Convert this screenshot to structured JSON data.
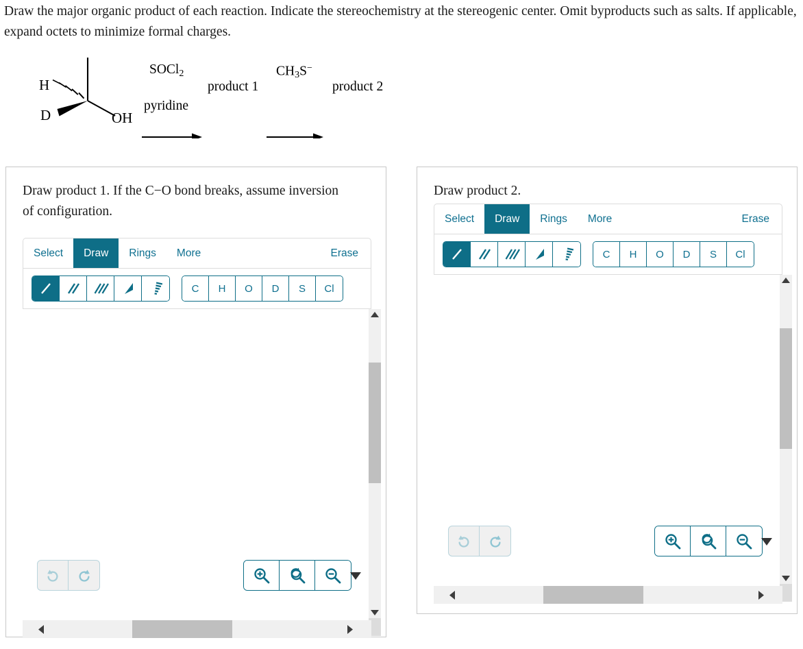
{
  "prompt": "Draw the major organic product of each reaction. Indicate the stereochemistry at the stereogenic center. Omit byproducts such as salts. If applicable, expand octets to minimize formal charges.",
  "reaction": {
    "substrate": {
      "hydrogen_label": "H",
      "deuterium_label": "D",
      "hydroxyl_label": "OH"
    },
    "step1": {
      "reagent_above": "SOCl",
      "reagent_above_sub": "2",
      "reagent_below": "pyridine",
      "product_label": "product 1"
    },
    "step2": {
      "reagent_above_pre": "CH",
      "reagent_above_sub": "3",
      "reagent_above_post": "S",
      "reagent_above_sup": "−",
      "product_label": "product 2"
    }
  },
  "accent_color": "#0e6e87",
  "accent_text_color": "#0f7090",
  "panels": [
    {
      "id": "left",
      "prompt": "Draw product 1. If the C−O bond breaks, assume inversion of configuration.",
      "tabs": [
        {
          "label": "Select",
          "active": false
        },
        {
          "label": "Draw",
          "active": true
        },
        {
          "label": "Rings",
          "active": false
        },
        {
          "label": "More",
          "active": false
        }
      ],
      "erase_label": "Erase",
      "bond_tools": [
        {
          "name": "single-bond",
          "active": true
        },
        {
          "name": "double-bond",
          "active": false
        },
        {
          "name": "triple-bond",
          "active": false
        },
        {
          "name": "wedge-bond",
          "active": false
        },
        {
          "name": "hash-bond",
          "active": false
        }
      ],
      "elements": [
        "C",
        "H",
        "O",
        "D",
        "S",
        "Cl"
      ],
      "undo_label": "Undo",
      "redo_label": "Redo",
      "zoom_in_label": "Zoom in",
      "zoom_reset_label": "Reset zoom",
      "zoom_out_label": "Zoom out"
    },
    {
      "id": "right",
      "prompt": "Draw product 2.",
      "tabs": [
        {
          "label": "Select",
          "active": false
        },
        {
          "label": "Draw",
          "active": true
        },
        {
          "label": "Rings",
          "active": false
        },
        {
          "label": "More",
          "active": false
        }
      ],
      "erase_label": "Erase",
      "bond_tools": [
        {
          "name": "single-bond",
          "active": true
        },
        {
          "name": "double-bond",
          "active": false
        },
        {
          "name": "triple-bond",
          "active": false
        },
        {
          "name": "wedge-bond",
          "active": false
        },
        {
          "name": "hash-bond",
          "active": false
        }
      ],
      "elements": [
        "C",
        "H",
        "O",
        "D",
        "S",
        "Cl"
      ],
      "undo_label": "Undo",
      "redo_label": "Redo",
      "zoom_in_label": "Zoom in",
      "zoom_reset_label": "Reset zoom",
      "zoom_out_label": "Zoom out"
    }
  ]
}
